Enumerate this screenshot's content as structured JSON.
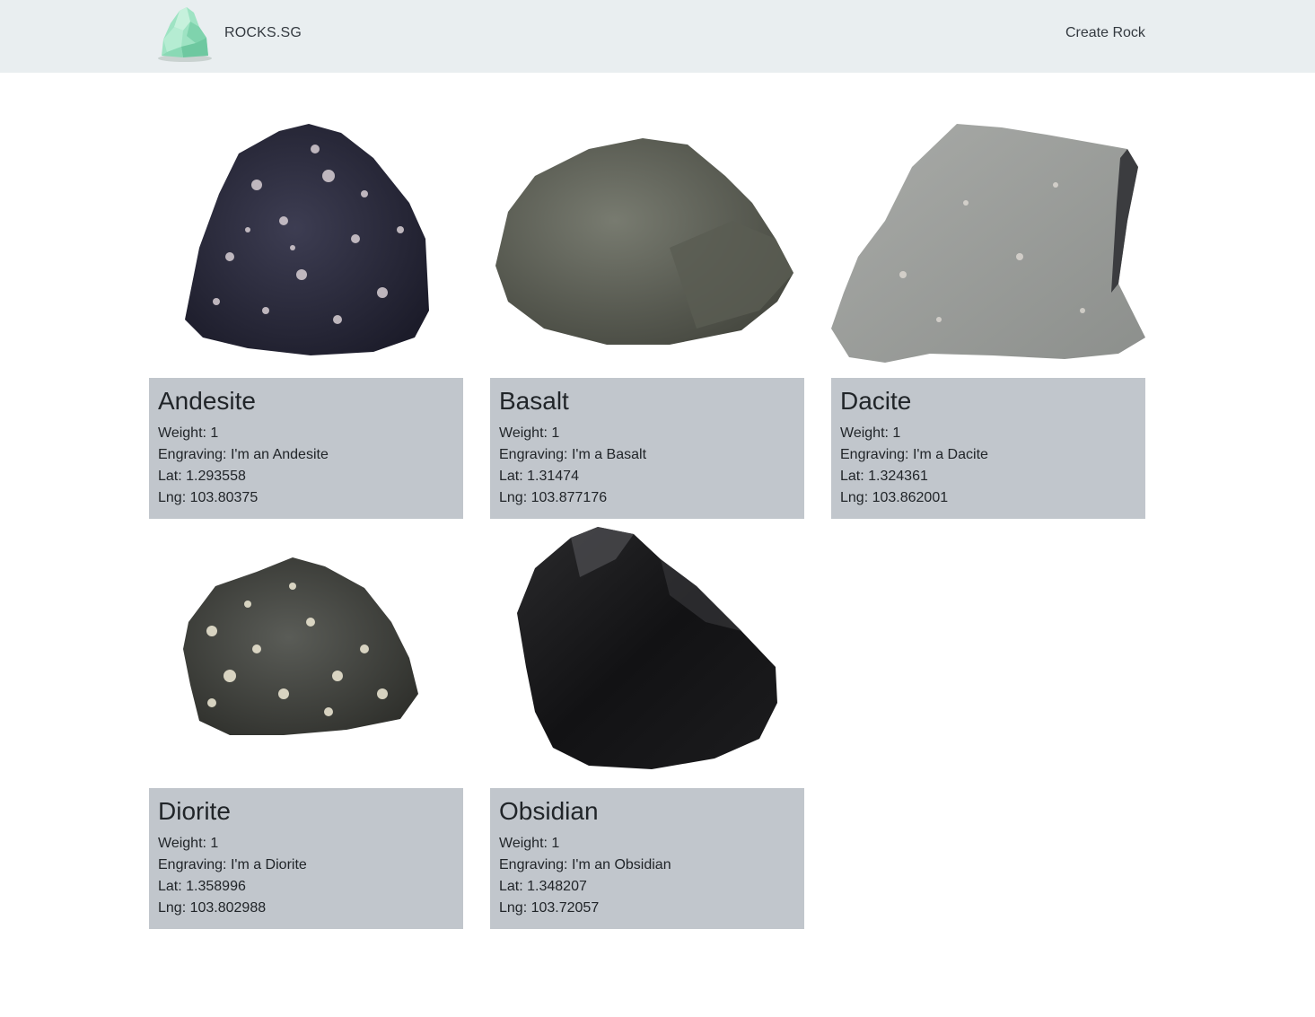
{
  "navbar": {
    "brand": "ROCKS.SG",
    "create_label": "Create Rock",
    "logo_icon": "green-crystal-icon"
  },
  "rocks": [
    {
      "name": "Andesite",
      "weight": "Weight: 1",
      "engraving": "Engraving: I'm an Andesite",
      "lat": "Lat: 1.293558",
      "lng": "Lng: 103.80375",
      "image": "andesite-rock-photo"
    },
    {
      "name": "Basalt",
      "weight": "Weight: 1",
      "engraving": "Engraving: I'm a Basalt",
      "lat": "Lat: 1.31474",
      "lng": "Lng: 103.877176",
      "image": "basalt-rock-photo"
    },
    {
      "name": "Dacite",
      "weight": "Weight: 1",
      "engraving": "Engraving: I'm a Dacite",
      "lat": "Lat: 1.324361",
      "lng": "Lng: 103.862001",
      "image": "dacite-rock-photo"
    },
    {
      "name": "Diorite",
      "weight": "Weight: 1",
      "engraving": "Engraving: I'm a Diorite",
      "lat": "Lat: 1.358996",
      "lng": "Lng: 103.802988",
      "image": "diorite-rock-photo"
    },
    {
      "name": "Obsidian",
      "weight": "Weight: 1",
      "engraving": "Engraving: I'm an Obsidian",
      "lat": "Lat: 1.348207",
      "lng": "Lng: 103.72057",
      "image": "obsidian-rock-photo"
    }
  ],
  "colors": {
    "navbar_bg": "#e9eef0",
    "card_body_bg": "#c1c6cc",
    "text": "#212529",
    "logo_green": "#8fdcb8"
  }
}
